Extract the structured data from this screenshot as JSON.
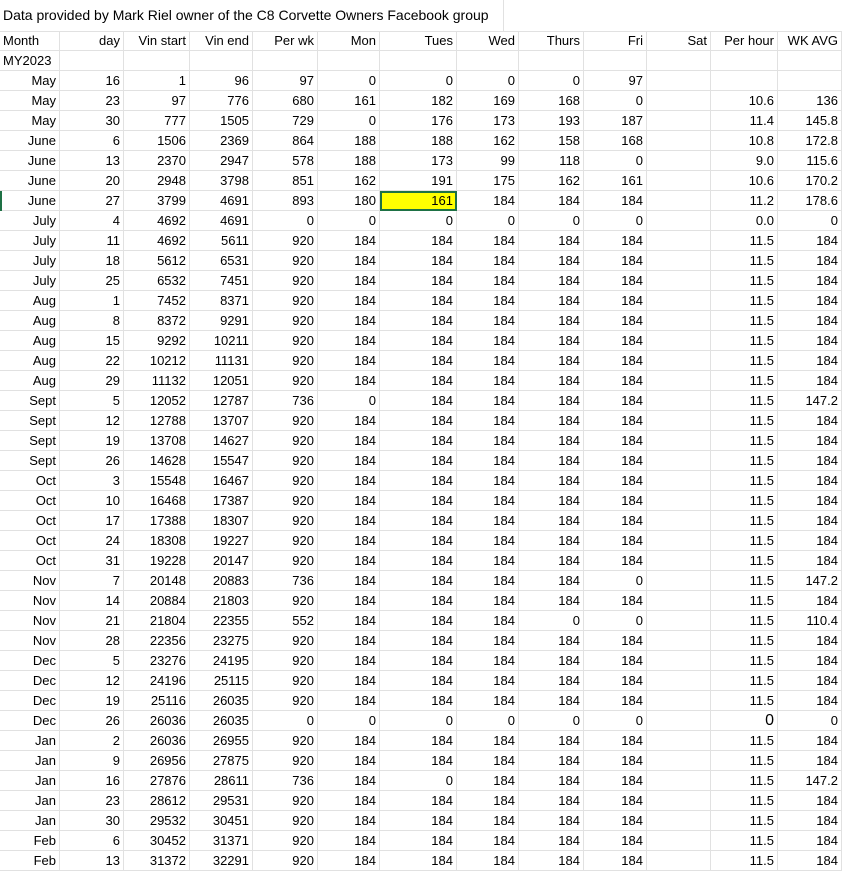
{
  "title": "Data provided by Mark Riel owner of the C8 Corvette Owners Facebook group",
  "headers": [
    "Month",
    "day",
    "Vin start",
    "Vin end",
    "Per wk",
    "Mon",
    "Tues",
    "Wed",
    "Thurs",
    "Fri",
    "Sat",
    "Per hour",
    "WK AVG"
  ],
  "subheader": "MY2023",
  "rows": [
    [
      "May",
      "16",
      "1",
      "96",
      "97",
      "0",
      "0",
      "0",
      "0",
      "97",
      "",
      "",
      ""
    ],
    [
      "May",
      "23",
      "97",
      "776",
      "680",
      "161",
      "182",
      "169",
      "168",
      "0",
      "",
      "10.6",
      "136"
    ],
    [
      "May",
      "30",
      "777",
      "1505",
      "729",
      "0",
      "176",
      "173",
      "193",
      "187",
      "",
      "11.4",
      "145.8"
    ],
    [
      "June",
      "6",
      "1506",
      "2369",
      "864",
      "188",
      "188",
      "162",
      "158",
      "168",
      "",
      "10.8",
      "172.8"
    ],
    [
      "June",
      "13",
      "2370",
      "2947",
      "578",
      "188",
      "173",
      "99",
      "118",
      "0",
      "",
      "9.0",
      "115.6"
    ],
    [
      "June",
      "20",
      "2948",
      "3798",
      "851",
      "162",
      "191",
      "175",
      "162",
      "161",
      "",
      "10.6",
      "170.2"
    ],
    [
      "June",
      "27",
      "3799",
      "4691",
      "893",
      "180",
      "161",
      "184",
      "184",
      "184",
      "",
      "11.2",
      "178.6"
    ],
    [
      "July",
      "4",
      "4692",
      "4691",
      "0",
      "0",
      "0",
      "0",
      "0",
      "0",
      "",
      "0.0",
      "0"
    ],
    [
      "July",
      "11",
      "4692",
      "5611",
      "920",
      "184",
      "184",
      "184",
      "184",
      "184",
      "",
      "11.5",
      "184"
    ],
    [
      "July",
      "18",
      "5612",
      "6531",
      "920",
      "184",
      "184",
      "184",
      "184",
      "184",
      "",
      "11.5",
      "184"
    ],
    [
      "July",
      "25",
      "6532",
      "7451",
      "920",
      "184",
      "184",
      "184",
      "184",
      "184",
      "",
      "11.5",
      "184"
    ],
    [
      "Aug",
      "1",
      "7452",
      "8371",
      "920",
      "184",
      "184",
      "184",
      "184",
      "184",
      "",
      "11.5",
      "184"
    ],
    [
      "Aug",
      "8",
      "8372",
      "9291",
      "920",
      "184",
      "184",
      "184",
      "184",
      "184",
      "",
      "11.5",
      "184"
    ],
    [
      "Aug",
      "15",
      "9292",
      "10211",
      "920",
      "184",
      "184",
      "184",
      "184",
      "184",
      "",
      "11.5",
      "184"
    ],
    [
      "Aug",
      "22",
      "10212",
      "11131",
      "920",
      "184",
      "184",
      "184",
      "184",
      "184",
      "",
      "11.5",
      "184"
    ],
    [
      "Aug",
      "29",
      "11132",
      "12051",
      "920",
      "184",
      "184",
      "184",
      "184",
      "184",
      "",
      "11.5",
      "184"
    ],
    [
      "Sept",
      "5",
      "12052",
      "12787",
      "736",
      "0",
      "184",
      "184",
      "184",
      "184",
      "",
      "11.5",
      "147.2"
    ],
    [
      "Sept",
      "12",
      "12788",
      "13707",
      "920",
      "184",
      "184",
      "184",
      "184",
      "184",
      "",
      "11.5",
      "184"
    ],
    [
      "Sept",
      "19",
      "13708",
      "14627",
      "920",
      "184",
      "184",
      "184",
      "184",
      "184",
      "",
      "11.5",
      "184"
    ],
    [
      "Sept",
      "26",
      "14628",
      "15547",
      "920",
      "184",
      "184",
      "184",
      "184",
      "184",
      "",
      "11.5",
      "184"
    ],
    [
      "Oct",
      "3",
      "15548",
      "16467",
      "920",
      "184",
      "184",
      "184",
      "184",
      "184",
      "",
      "11.5",
      "184"
    ],
    [
      "Oct",
      "10",
      "16468",
      "17387",
      "920",
      "184",
      "184",
      "184",
      "184",
      "184",
      "",
      "11.5",
      "184"
    ],
    [
      "Oct",
      "17",
      "17388",
      "18307",
      "920",
      "184",
      "184",
      "184",
      "184",
      "184",
      "",
      "11.5",
      "184"
    ],
    [
      "Oct",
      "24",
      "18308",
      "19227",
      "920",
      "184",
      "184",
      "184",
      "184",
      "184",
      "",
      "11.5",
      "184"
    ],
    [
      "Oct",
      "31",
      "19228",
      "20147",
      "920",
      "184",
      "184",
      "184",
      "184",
      "184",
      "",
      "11.5",
      "184"
    ],
    [
      "Nov",
      "7",
      "20148",
      "20883",
      "736",
      "184",
      "184",
      "184",
      "184",
      "0",
      "",
      "11.5",
      "147.2"
    ],
    [
      "Nov",
      "14",
      "20884",
      "21803",
      "920",
      "184",
      "184",
      "184",
      "184",
      "184",
      "",
      "11.5",
      "184"
    ],
    [
      "Nov",
      "21",
      "21804",
      "22355",
      "552",
      "184",
      "184",
      "184",
      "0",
      "0",
      "",
      "11.5",
      "110.4"
    ],
    [
      "Nov",
      "28",
      "22356",
      "23275",
      "920",
      "184",
      "184",
      "184",
      "184",
      "184",
      "",
      "11.5",
      "184"
    ],
    [
      "Dec",
      "5",
      "23276",
      "24195",
      "920",
      "184",
      "184",
      "184",
      "184",
      "184",
      "",
      "11.5",
      "184"
    ],
    [
      "Dec",
      "12",
      "24196",
      "25115",
      "920",
      "184",
      "184",
      "184",
      "184",
      "184",
      "",
      "11.5",
      "184"
    ],
    [
      "Dec",
      "19",
      "25116",
      "26035",
      "920",
      "184",
      "184",
      "184",
      "184",
      "184",
      "",
      "11.5",
      "184"
    ],
    [
      "Dec",
      "26",
      "26036",
      "26035",
      "0",
      "0",
      "0",
      "0",
      "0",
      "0",
      "",
      "0",
      "0"
    ],
    [
      "Jan",
      "2",
      "26036",
      "26955",
      "920",
      "184",
      "184",
      "184",
      "184",
      "184",
      "",
      "11.5",
      "184"
    ],
    [
      "Jan",
      "9",
      "26956",
      "27875",
      "920",
      "184",
      "184",
      "184",
      "184",
      "184",
      "",
      "11.5",
      "184"
    ],
    [
      "Jan",
      "16",
      "27876",
      "28611",
      "736",
      "184",
      "0",
      "184",
      "184",
      "184",
      "",
      "11.5",
      "147.2"
    ],
    [
      "Jan",
      "23",
      "28612",
      "29531",
      "920",
      "184",
      "184",
      "184",
      "184",
      "184",
      "",
      "11.5",
      "184"
    ],
    [
      "Jan",
      "30",
      "29532",
      "30451",
      "920",
      "184",
      "184",
      "184",
      "184",
      "184",
      "",
      "11.5",
      "184"
    ],
    [
      "Feb",
      "6",
      "30452",
      "31371",
      "920",
      "184",
      "184",
      "184",
      "184",
      "184",
      "",
      "11.5",
      "184"
    ],
    [
      "Feb",
      "13",
      "31372",
      "32291",
      "920",
      "184",
      "184",
      "184",
      "184",
      "184",
      "",
      "11.5",
      "184"
    ]
  ],
  "selected_cell": {
    "row": 6,
    "col": 6
  },
  "colors": {
    "highlight": "#ffff00",
    "selection_border": "#1e7145",
    "gridline": "#e1e1e1"
  }
}
